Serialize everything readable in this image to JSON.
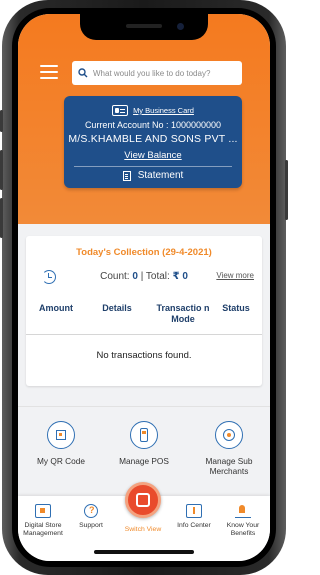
{
  "header": {
    "search_placeholder": "What would you like to do today?"
  },
  "account": {
    "business_card_label": "My Business Card",
    "account_no": "Current Account No : 1000000000",
    "account_name": "M/S.KHAMBLE AND SONS PVT ...",
    "view_balance": "View Balance",
    "statement": "Statement"
  },
  "collection": {
    "title": "Today's Collection (29-4-2021)",
    "count_label": "Count:",
    "count_value": "0",
    "total_label": "Total:",
    "total_value": "₹ 0",
    "view_more": "View more",
    "columns": [
      "Amount",
      "Details",
      "Transactio n Mode",
      "Status"
    ],
    "empty_message": "No transactions found."
  },
  "quick_actions": [
    {
      "label": "My QR Code",
      "icon": "qr-code-icon"
    },
    {
      "label": "Manage POS",
      "icon": "pos-icon"
    },
    {
      "label": "Manage Sub Merchants",
      "icon": "merchants-icon"
    }
  ],
  "bottom_nav": [
    {
      "label": "Digital Store Management",
      "icon": "store-icon"
    },
    {
      "label": "Support",
      "icon": "support-icon"
    },
    {
      "label": "Switch View",
      "icon": "switch-icon"
    },
    {
      "label": "Info Center",
      "icon": "info-icon"
    },
    {
      "label": "Know Your Benefits",
      "icon": "benefits-icon"
    }
  ],
  "colors": {
    "header_orange": "#f47a1f",
    "card_blue": "#1f4f8a",
    "accent_orange": "#f08a2a",
    "switch_red": "#e94b2c"
  }
}
